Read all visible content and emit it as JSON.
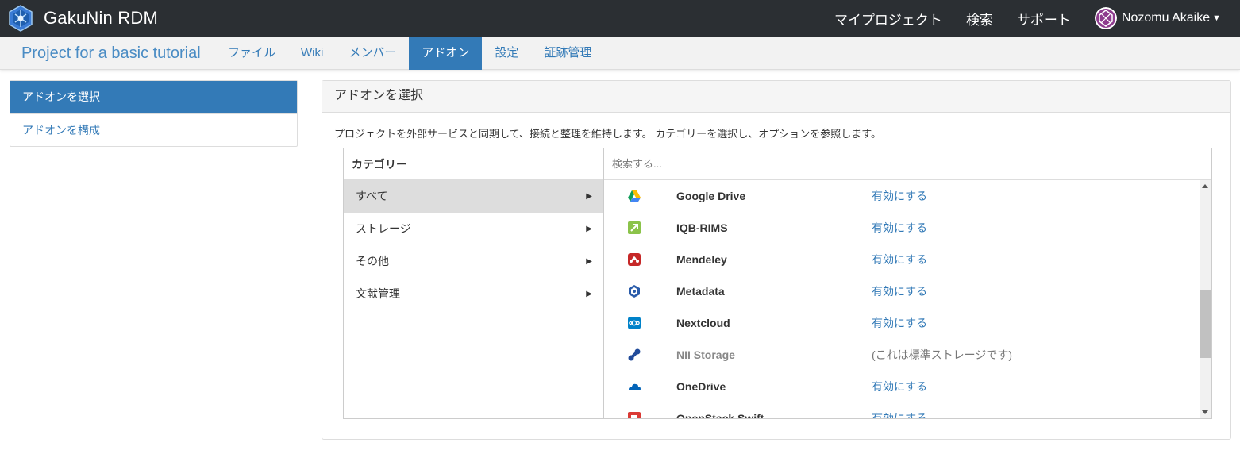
{
  "app": {
    "name": "GakuNin RDM"
  },
  "topnav": {
    "links": [
      "マイプロジェクト",
      "検索",
      "サポート"
    ],
    "user": "Nozomu Akaike"
  },
  "project": {
    "title": "Project for a basic tutorial",
    "tabs": [
      "ファイル",
      "Wiki",
      "メンバー",
      "アドオン",
      "設定",
      "証跡管理"
    ],
    "active_tab": "アドオン"
  },
  "sidebar": {
    "items": [
      "アドオンを選択",
      "アドオンを構成"
    ]
  },
  "panel": {
    "title": "アドオンを選択",
    "description": "プロジェクトを外部サービスと同期して、接続と整理を維持します。 カテゴリーを選択し、オプションを参照します。"
  },
  "categories": {
    "header": "カテゴリー",
    "items": [
      "すべて",
      "ストレージ",
      "その他",
      "文献管理"
    ]
  },
  "search": {
    "placeholder": "検索する..."
  },
  "addons": [
    {
      "name": "Google Drive",
      "action": "有効にする",
      "icon": "google-drive-icon"
    },
    {
      "name": "IQB-RIMS",
      "action": "有効にする",
      "icon": "iqb-rims-icon"
    },
    {
      "name": "Mendeley",
      "action": "有効にする",
      "icon": "mendeley-icon"
    },
    {
      "name": "Metadata",
      "action": "有効にする",
      "icon": "metadata-icon"
    },
    {
      "name": "Nextcloud",
      "action": "有効にする",
      "icon": "nextcloud-icon"
    },
    {
      "name": "NII Storage",
      "action": "(これは標準ストレージです)",
      "icon": "nii-storage-icon"
    },
    {
      "name": "OneDrive",
      "action": "有効にする",
      "icon": "onedrive-icon"
    },
    {
      "name": "OpenStack Swift",
      "action": "有効にする",
      "icon": "openstack-swift-icon"
    }
  ],
  "colors": {
    "accent": "#337ab7",
    "topbar": "#2b2f33"
  }
}
